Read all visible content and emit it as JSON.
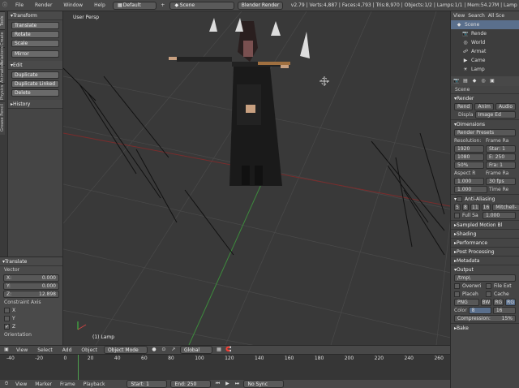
{
  "topbar": {
    "menus": [
      "File",
      "Render",
      "Window",
      "Help"
    ],
    "layout": "Default",
    "scene": "Scene",
    "engine": "Blender Render",
    "stats": "v2.79 | Verts:4,887 | Faces:4,793 | Tris:8,970 | Objects:1/2 | Lamps:1/1 | Mem:54.27M | Lamp"
  },
  "tabs": [
    "Tools",
    "Create",
    "Relations",
    "Animation",
    "Physics",
    "Grease Pencil"
  ],
  "tools": {
    "transform_header": "Transform",
    "transform_buttons": [
      "Translate",
      "Rotate",
      "Scale",
      "Mirror"
    ],
    "edit_header": "Edit",
    "edit_buttons": [
      "Duplicate",
      "Duplicate Linked",
      "Delete"
    ],
    "history_header": "History"
  },
  "redo": {
    "header": "Translate",
    "vector_label": "Vector",
    "x": {
      "label": "X:",
      "value": "0.000"
    },
    "y": {
      "label": "Y:",
      "value": "0.000"
    },
    "z": {
      "label": "Z:",
      "value": "12.898"
    },
    "constraint_label": "Constraint Axis",
    "axes": [
      "X",
      "Y",
      "Z"
    ],
    "orientation_label": "Orientation"
  },
  "viewport": {
    "label": "User Persp",
    "object_label": "(1) Lamp"
  },
  "view_header": {
    "menus": [
      "View",
      "Select",
      "Add",
      "Object"
    ],
    "mode": "Object Mode",
    "orientation": "Global"
  },
  "timeline": {
    "ticks": [
      "-40",
      "-20",
      "0",
      "20",
      "40",
      "60",
      "80",
      "100",
      "120",
      "140",
      "160",
      "180",
      "200",
      "220",
      "240",
      "260"
    ],
    "menus": [
      "View",
      "Marker",
      "Frame",
      "Playback"
    ],
    "start": "Start:",
    "start_val": "1",
    "end": "End:",
    "end_val": "250",
    "sync": "No Sync"
  },
  "outliner": {
    "tabs": [
      "View",
      "Search",
      "All Sce"
    ],
    "items": [
      "Scene",
      "Rende",
      "World",
      "Armat",
      "Came",
      "Lamp"
    ]
  },
  "props": {
    "scene": "Scene",
    "render": "Render",
    "render_btns": [
      "Rend",
      "Anim",
      "Audio"
    ],
    "display_label": "Displa",
    "display_val": "Image Ed",
    "dimensions": "Dimensions",
    "presets": "Render Presets",
    "resolution": "Resolution:",
    "res_x": "1920",
    "res_y": "1080",
    "res_pct": "50%",
    "frame_range": "Frame Ra",
    "start": "Star: 1",
    "end": "E: 250",
    "frame": "Fra: 1",
    "aspect": "Aspect R",
    "asp_x": "1.000",
    "asp_y": "1.000",
    "frame_rate": "Frame Ra",
    "fps": "30 fps",
    "time_re": "Time Re",
    "aa": "Anti-Aliasing",
    "aa_samples": [
      "5",
      "8",
      "11",
      "16"
    ],
    "aa_filter": "Mitchell-",
    "full_sa": "Full Sa",
    "full_val": "1.000",
    "motion": "Sampled Motion Bl",
    "sections": [
      "Shading",
      "Performance",
      "Post Processing",
      "Metadata",
      "Output"
    ],
    "output_path": "/tmp\\",
    "overwrite": "Overwri",
    "file_ext": "File Ext",
    "placeh": "Placeh",
    "cache": "Cache",
    "format": "PNG",
    "color_modes": [
      "BW",
      "RG",
      "RG"
    ],
    "color": "Color",
    "color_val": "8",
    "color_val2": "16",
    "compression": "Compression:",
    "compression_val": "15%",
    "bake": "Bake"
  }
}
